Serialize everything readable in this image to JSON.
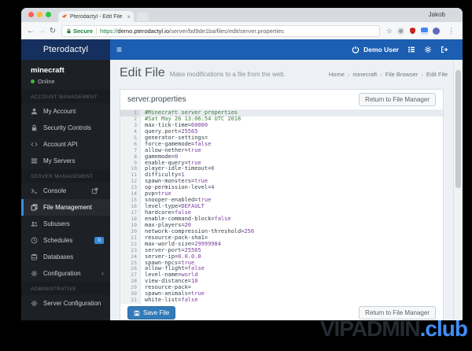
{
  "browser": {
    "tab": {
      "title": "Pterodactyl - Edit File",
      "close": "×"
    },
    "profile": "Jakob",
    "toolbar": {
      "back": "←",
      "forward": "→",
      "reload": "↻",
      "secure_label": "Secure",
      "url": "https://demo.pterodactyl.io/server/bd9de1ba/files/edit/server.properties",
      "bookmark": "☆",
      "menu": "⋮"
    }
  },
  "app": {
    "brand": "Pterodactyl",
    "menu_icon": "≡",
    "user": "Demo User"
  },
  "sidebar": {
    "server_name": "minecraft",
    "status": "Online",
    "sections": [
      {
        "label": "ACCOUNT MANAGEMENT",
        "items": [
          {
            "icon": "user-icon",
            "label": "My Account"
          },
          {
            "icon": "lock-icon",
            "label": "Security Controls"
          },
          {
            "icon": "code-icon",
            "label": "Account API"
          },
          {
            "icon": "list-icon",
            "label": "My Servers"
          }
        ]
      },
      {
        "label": "SERVER MANAGEMENT",
        "items": [
          {
            "icon": "terminal-icon",
            "label": "Console",
            "trailing": "external-link-icon"
          },
          {
            "icon": "files-icon",
            "label": "File Management",
            "active": true
          },
          {
            "icon": "users-icon",
            "label": "Subusers"
          },
          {
            "icon": "clock-icon",
            "label": "Schedules",
            "badge": "0"
          },
          {
            "icon": "database-icon",
            "label": "Databases"
          },
          {
            "icon": "cogs-icon",
            "label": "Configuration",
            "trailing": "chevron-left-icon"
          }
        ]
      },
      {
        "label": "ADMINISTRATIVE",
        "items": [
          {
            "icon": "wrench-icon",
            "label": "Server Configuration"
          }
        ]
      }
    ]
  },
  "page": {
    "title": "Edit File",
    "subtitle": "Make modifications to a file from the web.",
    "breadcrumb": [
      "Home",
      "minecraft",
      "File Browser",
      "Edit File"
    ],
    "breadcrumb_separator": "›"
  },
  "panel": {
    "heading": "server.properties",
    "return_button": "Return to File Manager",
    "save_button": "Save File"
  },
  "editor": {
    "active_line": 1,
    "lines": [
      "#Minecraft server properties",
      "#Sat May 26 13:06:54 UTC 2018",
      "max-tick-time=60000",
      "query.port=25565",
      "generator-settings=",
      "force-gamemode=false",
      "allow-nether=true",
      "gamemode=0",
      "enable-query=true",
      "player-idle-timeout=0",
      "difficulty=1",
      "spawn-monsters=true",
      "op-permission-level=4",
      "pvp=true",
      "snooper-enabled=true",
      "level-type=DEFAULT",
      "hardcore=false",
      "enable-command-block=false",
      "max-players=20",
      "network-compression-threshold=256",
      "resource-pack-sha1=",
      "max-world-size=29999984",
      "server-port=25565",
      "server-ip=0.0.0.0",
      "spawn-npcs=true",
      "allow-flight=false",
      "level-name=world",
      "view-distance=10",
      "resource-pack=",
      "spawn-animals=true",
      "white-list=false"
    ]
  },
  "watermark": {
    "name": "VIPADMIN",
    "tld": ".club"
  },
  "colors": {
    "header_blue": "#1b5eb2",
    "brand_navy": "#152f5e",
    "sidebar_bg": "#1d2126",
    "active_item_blue": "#3a8fd8",
    "online_green": "#42b542",
    "badge_blue": "#3888d8",
    "content_bg": "#edf1f6",
    "save_button_blue": "#337ab7",
    "comment_green": "#3f7f3f",
    "key_color": "#36414b",
    "value_purple": "#7a3e9d",
    "watermark_blue": "#3f8ef7"
  }
}
